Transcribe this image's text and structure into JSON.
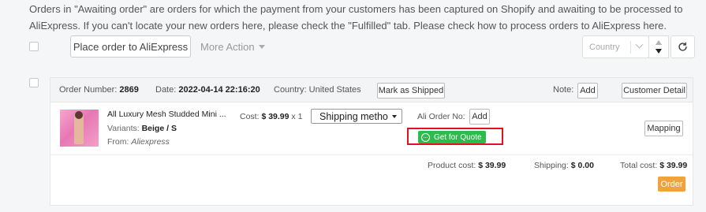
{
  "notice": {
    "text": "Orders in \"Awaiting order\" are orders for which the payment from your customers has been captured on Shopify and awaiting to be processed to AliExpress. If you can't locate your new orders here, please check the \"Fulfilled\" tab. Please check how to process orders to AliExpress here."
  },
  "toolbar": {
    "place_order_label": "Place order to AliExpress",
    "more_action_label": "More Action",
    "country_placeholder": "Country"
  },
  "order": {
    "number_label": "Order Number:",
    "number": "2869",
    "date_label": "Date:",
    "date": "2022-04-14 22:16:20",
    "country_label": "Country:",
    "country": "United States",
    "mark_shipped_label": "Mark as Shipped",
    "note_label": "Note:",
    "note_add_label": "Add",
    "customer_detail_label": "Customer Detail",
    "product": {
      "title": "All Luxury Mesh Studded Mini ...",
      "variants_label": "Variants:",
      "variants": "Beige / S",
      "from_label": "From:",
      "from": "Aliexpress",
      "cost_label": "Cost:",
      "cost": "$ 39.99",
      "qty": "x 1",
      "shipping_method": "Shipping metho",
      "ali_order_label": "Ali Order No:",
      "ali_add_label": "Add",
      "quote_label": "Get for Quote",
      "mapping_label": "Mapping"
    },
    "summary": {
      "product_cost_label": "Product cost:",
      "product_cost": "$ 39.99",
      "shipping_label": "Shipping:",
      "shipping": "$ 0.00",
      "total_label": "Total cost:",
      "total": "$ 39.99"
    },
    "order_button_label": "Order"
  },
  "colors": {
    "quote_green": "#2bbd4c",
    "highlight_red": "#e3101d",
    "order_orange": "#f0a33a"
  },
  "icons": [
    "caret-down-icon",
    "chevron-down-icon",
    "sort-icon",
    "refresh-icon",
    "chat-icon"
  ]
}
